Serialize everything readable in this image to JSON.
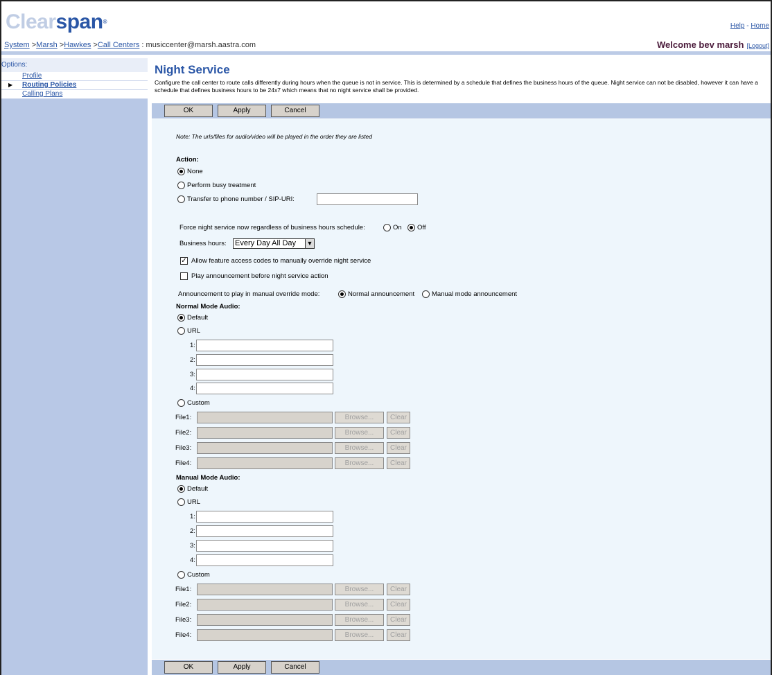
{
  "header": {
    "logo_part1": "Clear",
    "logo_part2": "span",
    "logo_mark": "®",
    "help": "Help",
    "separator": " - ",
    "home": "Home",
    "breadcrumb": [
      "System",
      "Marsh",
      "Hawkes",
      "Call Centers"
    ],
    "breadcrumb_sep": " >",
    "breadcrumb_tail": " : musiccenter@marsh.aastra.com",
    "welcome": "Welcome bev marsh",
    "logout": "[Logout]"
  },
  "sidebar": {
    "title": "Options:",
    "items": [
      {
        "label": "Profile",
        "active": false
      },
      {
        "label": "Routing Policies",
        "active": true
      },
      {
        "label": "Calling Plans",
        "active": false
      }
    ]
  },
  "page": {
    "title": "Night Service",
    "description": "Configure the call center to route calls differently during hours when the queue is not in service. This is determined by a schedule that defines the business hours of the queue. Night service can not be disabled, however it can have a schedule that defines business hours to be 24x7 which means that no night service shall be provided."
  },
  "buttons": {
    "ok": "OK",
    "apply": "Apply",
    "cancel": "Cancel"
  },
  "form": {
    "note": "Note: The urls/files for audio/video will be played in the order they are listed",
    "action_label": "Action:",
    "action_none": "None",
    "action_busy": "Perform busy treatment",
    "action_transfer": "Transfer to phone number / SIP-URI:",
    "transfer_value": "",
    "force_label": "Force night service now regardless of business hours schedule:",
    "force_on": "On",
    "force_off": "Off",
    "business_hours_label": "Business hours:",
    "business_hours_value": "Every Day All Day",
    "allow_fac": "Allow feature access codes to manually override night service",
    "play_announcement": "Play announcement before night service action",
    "announcement_mode_label": "Announcement to play in manual override mode:",
    "announcement_normal": "Normal announcement",
    "announcement_manual": "Manual mode announcement",
    "normal_mode_audio": "Normal Mode Audio:",
    "manual_mode_audio": "Manual Mode Audio:",
    "default": "Default",
    "url": "URL",
    "custom": "Custom",
    "url_nums": [
      "1:",
      "2:",
      "3:",
      "4:"
    ],
    "file_labels": [
      "File1:",
      "File2:",
      "File3:",
      "File4:"
    ],
    "browse": "Browse...",
    "clear": "Clear"
  },
  "colors": {
    "brand_blue": "#2a56a6",
    "bar_blue": "#b5c6e3",
    "content_bg": "#eef6fc"
  }
}
